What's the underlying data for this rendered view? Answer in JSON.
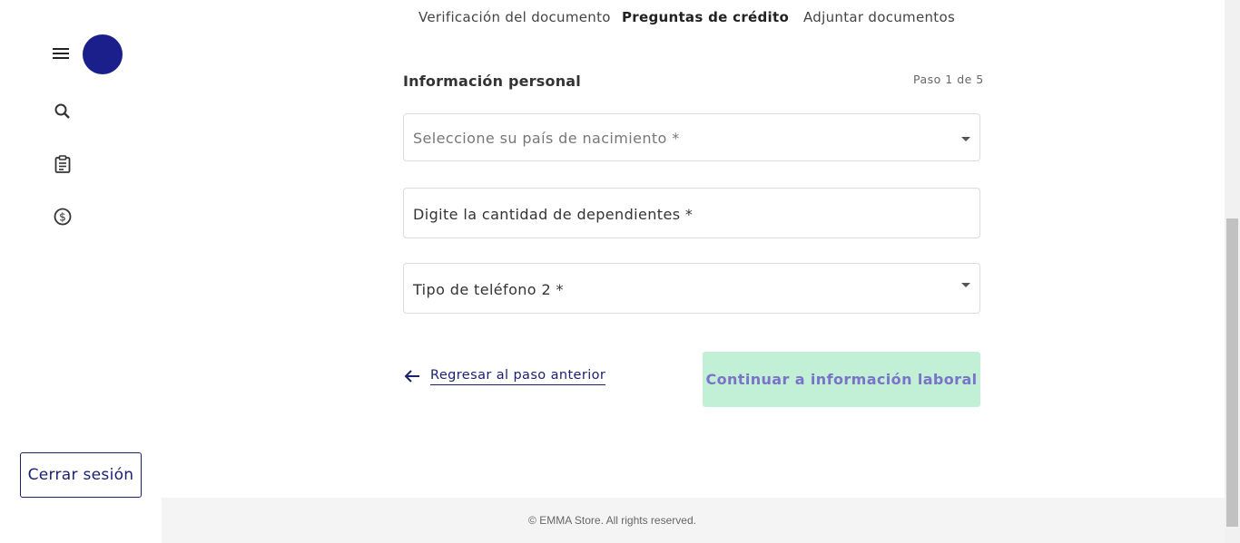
{
  "sidebar": {
    "icons": [
      "menu-icon",
      "search-icon",
      "clipboard-icon",
      "dollar-icon"
    ],
    "logout_label": "Cerrar sesión"
  },
  "tabs": [
    {
      "label": "Verificación del documento",
      "active": false
    },
    {
      "label": "Preguntas de crédito",
      "active": true
    },
    {
      "label": "Adjuntar documentos",
      "active": false
    }
  ],
  "form": {
    "title": "Información personal",
    "step": "Paso 1 de 5",
    "fields": [
      {
        "label": "Seleccione su país de nacimiento *",
        "type": "select"
      },
      {
        "label": "Digite la cantidad de dependientes *",
        "type": "text"
      },
      {
        "label": "Tipo de teléfono 2 *",
        "type": "select"
      }
    ],
    "back_label": "Regresar al paso anterior",
    "continue_label": "Continuar a información laboral"
  },
  "footer": {
    "text": "© EMMA Store. All rights reserved."
  },
  "colors": {
    "primary": "#1a1f8c",
    "button_bg": "#c1f0d7",
    "button_text": "#7a73c8"
  }
}
